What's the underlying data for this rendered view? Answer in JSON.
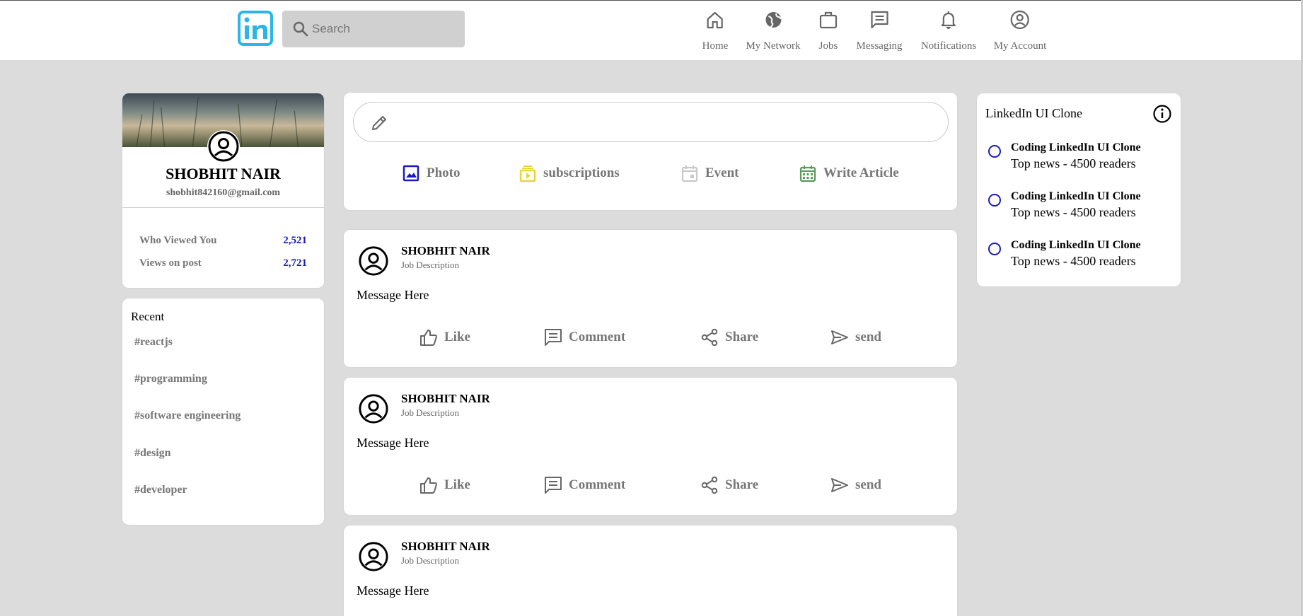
{
  "header": {
    "search_placeholder": "Search",
    "nav": [
      {
        "label": "Home",
        "icon": "home-icon"
      },
      {
        "label": "My Network",
        "icon": "globe-icon"
      },
      {
        "label": "Jobs",
        "icon": "briefcase-icon"
      },
      {
        "label": "Messaging",
        "icon": "message-icon"
      },
      {
        "label": "Notifications",
        "icon": "bell-icon"
      },
      {
        "label": "My Account",
        "icon": "account-circle-icon"
      }
    ]
  },
  "profile": {
    "name": "SHOBHIT NAIR",
    "email": "shobhit842160@gmail.com",
    "stats": [
      {
        "label": "Who Viewed You",
        "value": "2,521"
      },
      {
        "label": "Views on post",
        "value": "2,721"
      }
    ]
  },
  "recent": {
    "title": "Recent",
    "tags": [
      "#reactjs",
      "#programming",
      "#software engineering",
      "#design",
      "#developer"
    ]
  },
  "composer": {
    "actions": [
      {
        "label": "Photo",
        "icon": "image-icon",
        "color": "#1a1ab8"
      },
      {
        "label": "subscriptions",
        "icon": "subscriptions-icon",
        "color": "#e8d33f"
      },
      {
        "label": "Event",
        "icon": "calendar-icon",
        "color": "#c8c8c8"
      },
      {
        "label": "Write Article",
        "icon": "calendar-grid-icon",
        "color": "#5a9a5a"
      }
    ]
  },
  "posts": [
    {
      "name": "SHOBHIT NAIR",
      "description": "Job Description",
      "message": "Message Here"
    },
    {
      "name": "SHOBHIT NAIR",
      "description": "Job Description",
      "message": "Message Here"
    },
    {
      "name": "SHOBHIT NAIR",
      "description": "Job Description",
      "message": "Message Here"
    }
  ],
  "post_actions": [
    "Like",
    "Comment",
    "Share",
    "send"
  ],
  "news": {
    "title": "LinkedIn UI Clone",
    "items": [
      {
        "heading": "Coding LinkedIn UI Clone",
        "sub": "Top news - 4500 readers"
      },
      {
        "heading": "Coding LinkedIn UI Clone",
        "sub": "Top news - 4500 readers"
      },
      {
        "heading": "Coding LinkedIn UI Clone",
        "sub": "Top news - 4500 readers"
      }
    ]
  },
  "colors": {
    "background": "#dcdcdc",
    "accent_blue": "#1a1ab8",
    "logo_cyan": "#2bb5e8"
  }
}
